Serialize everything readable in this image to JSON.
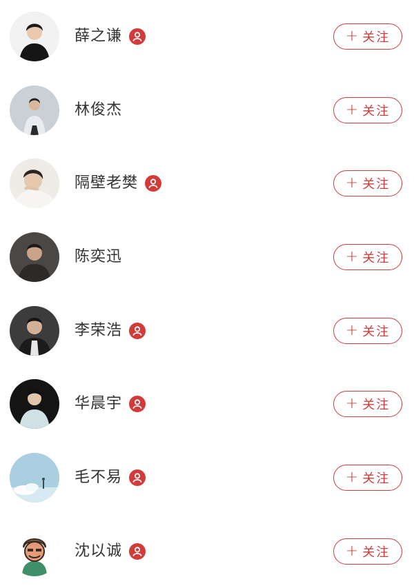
{
  "colors": {
    "accent": "#d33a3a",
    "name_text": "#333333",
    "background": "#ffffff"
  },
  "follow_button": {
    "plus_glyph": "+",
    "label": "关注"
  },
  "artists": [
    {
      "name": "薛之谦",
      "verified": true,
      "avatar_icon": "artist-avatar-icon"
    },
    {
      "name": "林俊杰",
      "verified": false,
      "avatar_icon": "artist-avatar-icon"
    },
    {
      "name": "隔壁老樊",
      "verified": true,
      "avatar_icon": "artist-avatar-icon"
    },
    {
      "name": "陈奕迅",
      "verified": false,
      "avatar_icon": "artist-avatar-icon"
    },
    {
      "name": "李荣浩",
      "verified": true,
      "avatar_icon": "artist-avatar-icon"
    },
    {
      "name": "华晨宇",
      "verified": true,
      "avatar_icon": "artist-avatar-icon"
    },
    {
      "name": "毛不易",
      "verified": true,
      "avatar_icon": "artist-avatar-icon"
    },
    {
      "name": "沈以诚",
      "verified": true,
      "avatar_icon": "artist-avatar-icon"
    }
  ]
}
